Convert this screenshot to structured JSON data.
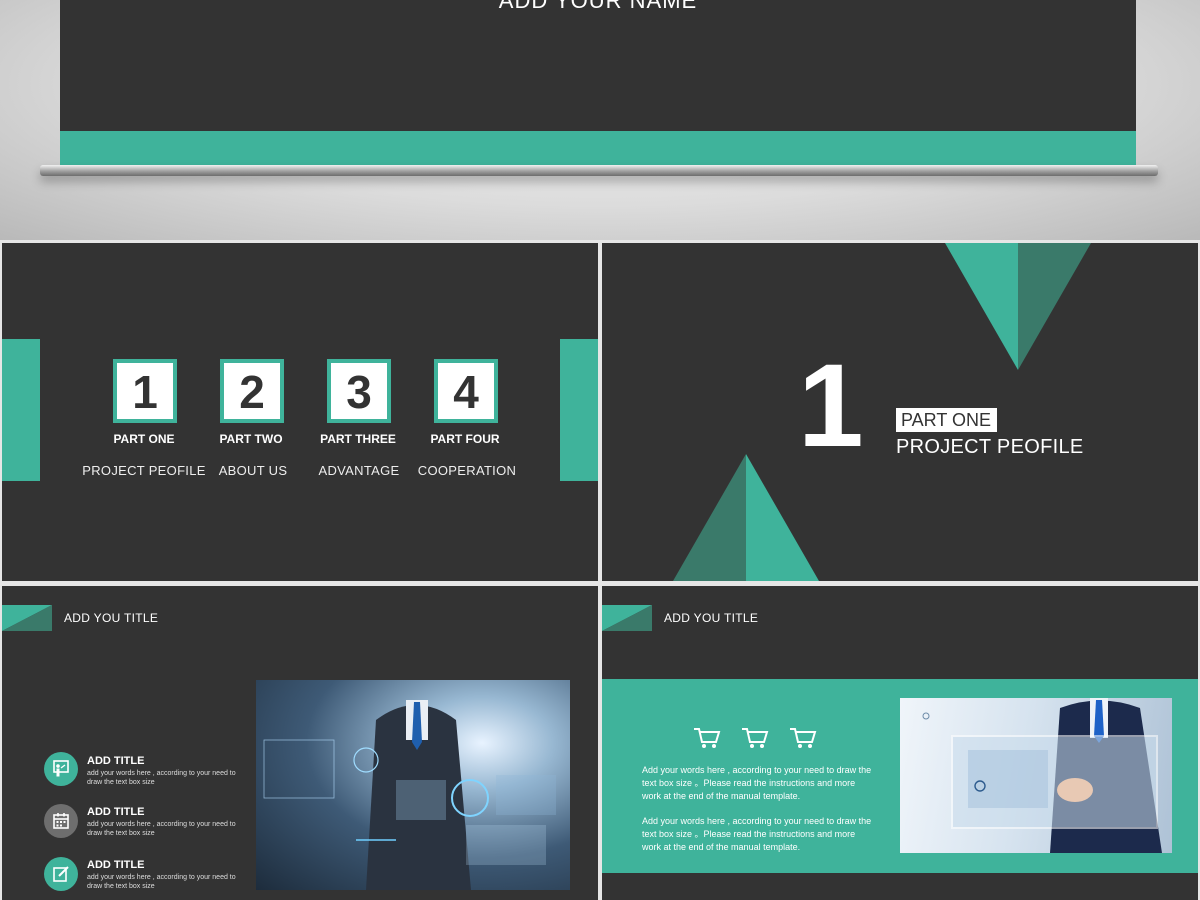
{
  "hero": {
    "name_text": "ADD YOUR NAME"
  },
  "agenda": {
    "items": [
      {
        "number": "1",
        "label": "PART ONE",
        "subtitle": "PROJECT PEOFILE"
      },
      {
        "number": "2",
        "label": "PART TWO",
        "subtitle": "ABOUT US"
      },
      {
        "number": "3",
        "label": "PART THREE",
        "subtitle": "ADVANTAGE"
      },
      {
        "number": "4",
        "label": "PART FOUR",
        "subtitle": "COOPERATION"
      }
    ]
  },
  "part_slide": {
    "number": "1",
    "tag": "PART ONE",
    "title": "PROJECT PEOFILE"
  },
  "content_a": {
    "title": "ADD YOU TITLE",
    "features": [
      {
        "title": "ADD TITLE",
        "desc": "add your words here ,   according to your need to draw the text box size",
        "icon": "presenter-icon",
        "color": "#3fb39b"
      },
      {
        "title": "ADD TITLE",
        "desc": "add your words here ,   according to your need to draw the text box size",
        "icon": "calendar-icon",
        "color": "#6e6e6e"
      },
      {
        "title": "ADD TITLE",
        "desc": "add your words here ,   according to your need to draw the text box size",
        "icon": "edit-icon",
        "color": "#3fb39b"
      }
    ]
  },
  "content_b": {
    "title": "ADD YOU TITLE",
    "icons": [
      "cart-icon",
      "cart-icon",
      "cart-icon"
    ],
    "paragraphs": [
      "Add your words here ,    according to your need to draw the text box size 。Please read the instructions and more work at the end of the manual template.",
      "Add your words here ,    according to your need to draw the text box size 。Please read the instructions and more work at the end of the manual template."
    ]
  },
  "colors": {
    "accent": "#3fb39b",
    "accent_dark": "#3a7a6a",
    "slide_bg": "#333333"
  }
}
